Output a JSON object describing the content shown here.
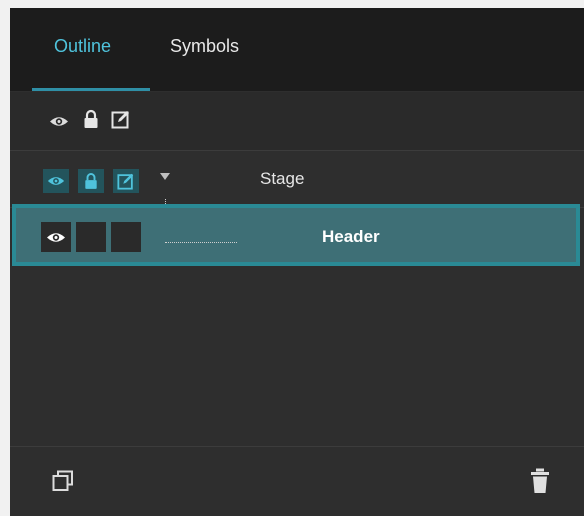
{
  "tabs": [
    {
      "label": "Outline",
      "active": true
    },
    {
      "label": "Symbols",
      "active": false
    }
  ],
  "layers": {
    "stage": {
      "label": "Stage",
      "expanded": true
    },
    "header": {
      "label": "Header",
      "selected": true
    }
  },
  "icons": {
    "visibility": "eye-icon",
    "lock": "lock-icon",
    "edit": "edit-icon",
    "duplicate": "duplicate-icon",
    "delete": "trash-icon"
  },
  "colors": {
    "accent": "#4fc3dc",
    "selection_bg": "#3e6f76",
    "selection_border": "#2a8a95",
    "panel_bg": "#2e2e2e"
  }
}
